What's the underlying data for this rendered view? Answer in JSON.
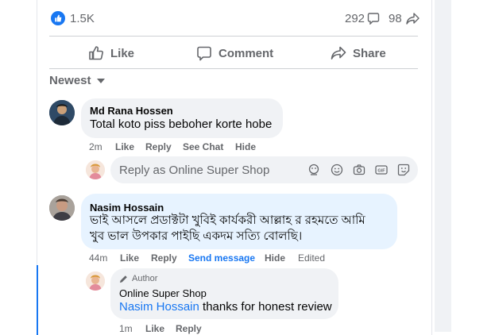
{
  "reactions": {
    "count": "1.5K",
    "comments": "292",
    "shares": "98"
  },
  "actions": {
    "like": "Like",
    "comment": "Comment",
    "share": "Share"
  },
  "sort": {
    "label": "Newest"
  },
  "comments": [
    {
      "author": "Md Rana Hossen",
      "text": "Total koto piss beboher korte hobe",
      "time": "2m",
      "like": "Like",
      "reply": "Reply",
      "see_chat": "See Chat",
      "hide": "Hide"
    },
    {
      "author": "Nasim Hossain",
      "text_line1": "ভাই আসলে প্রডাক্টটা খুবিই কার্যকরী আল্লাহ র রহমতে আমি",
      "text_line2": "খুব ভাল উপকার পাইছি একদম সত্যি বোলছি।",
      "time": "44m",
      "like": "Like",
      "reply": "Reply",
      "send_message": "Send message",
      "hide": "Hide",
      "edited": "Edited"
    }
  ],
  "reply_box": {
    "placeholder": "Reply as Online Super Shop"
  },
  "reply": {
    "badge": "Author",
    "author": "Online Super Shop",
    "mention": "Nasim Hossain",
    "text": " thanks for honest review",
    "time": "1m",
    "like": "Like",
    "reply": "Reply"
  },
  "colors": {
    "accent": "#1877f2",
    "bubble": "#f0f2f5",
    "highlight_bubble": "#e7f3ff",
    "thread_line": "#1877f2"
  }
}
